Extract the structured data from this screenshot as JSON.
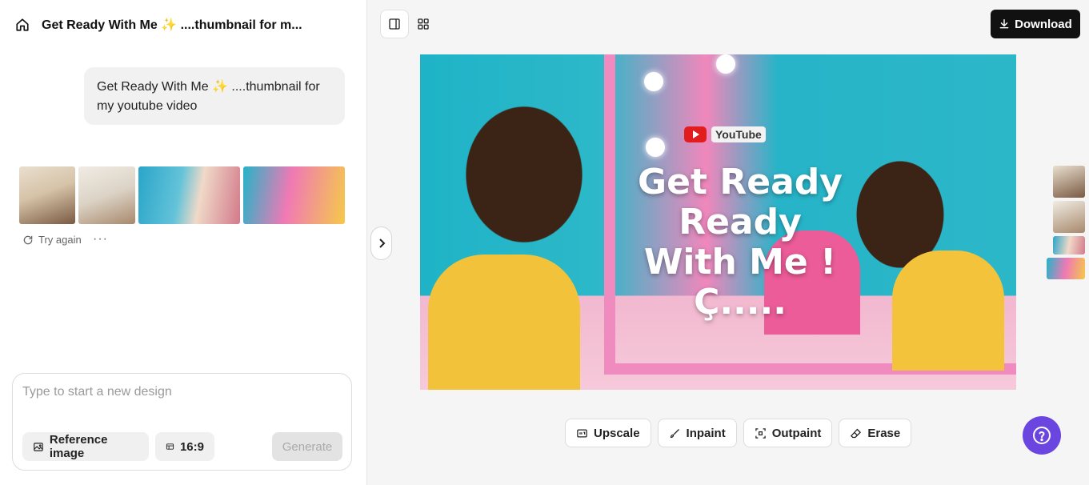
{
  "header": {
    "title": "Get Ready With Me ✨ ....thumbnail for m..."
  },
  "chat": {
    "message": "Get Ready With Me ✨ ....thumbnail for my youtube video",
    "actions": {
      "try_again": "Try again",
      "more": "···"
    }
  },
  "composer": {
    "placeholder": "Type to start a new design",
    "reference_label": "Reference image",
    "ratio_label": "16:9",
    "generate_label": "Generate"
  },
  "toolbar": {
    "download_label": "Download"
  },
  "preview": {
    "brand_text": "YouTube",
    "overlay_lines": [
      "Get Ready",
      "Ready",
      "With Me !",
      "Ç....."
    ]
  },
  "edit_tools": [
    "Upscale",
    "Inpaint",
    "Outpaint",
    "Erase"
  ],
  "colors": {
    "accent": "#6b45e0",
    "download_bg": "#111111"
  }
}
